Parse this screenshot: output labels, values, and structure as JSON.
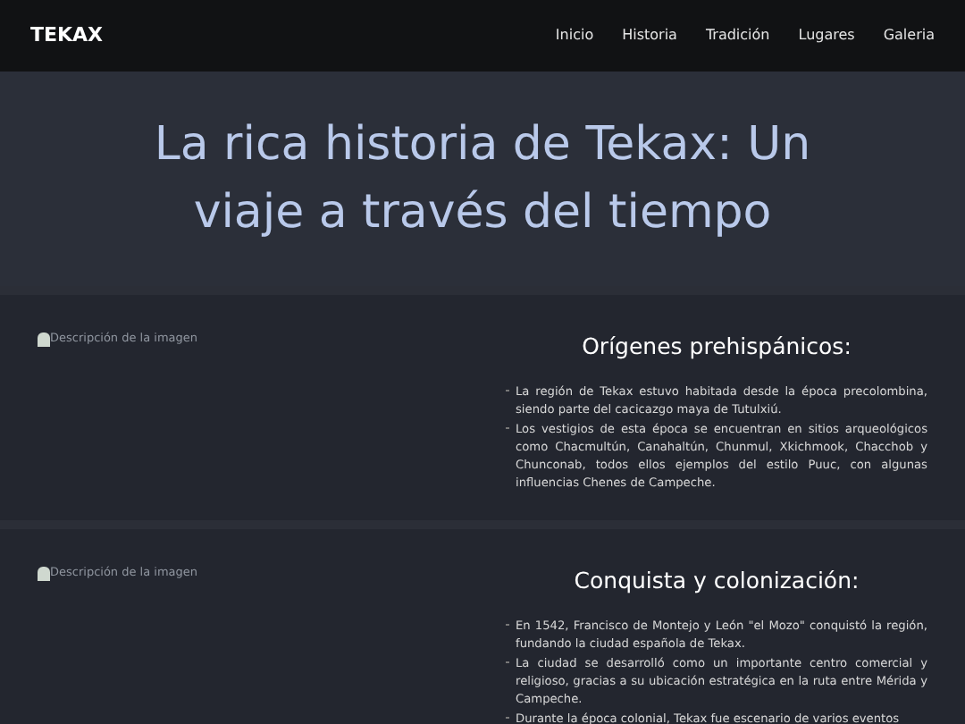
{
  "nav": {
    "brand": "TEKAX",
    "links": [
      "Inicio",
      "Historia",
      "Tradición",
      "Lugares",
      "Galeria"
    ]
  },
  "hero": {
    "title": "La rica historia de Tekax: Un viaje a través del tiempo"
  },
  "sections": [
    {
      "image_alt": "Descripción de la imagen",
      "heading": "Orígenes prehispánicos:",
      "bullets": [
        "La región de Tekax estuvo habitada desde la época precolombina, siendo parte del cacicazgo maya de Tutulxiú.",
        "Los vestigios de esta época se encuentran en sitios arqueológicos como Chacmultún, Canahaltún, Chunmul, Xkichmook, Chacchob y Chunconab, todos ellos ejemplos del estilo Puuc, con algunas influencias Chenes de Campeche."
      ]
    },
    {
      "image_alt": "Descripción de la imagen",
      "heading": "Conquista y colonización:",
      "bullets": [
        "En 1542, Francisco de Montejo y León \"el Mozo\" conquistó la región, fundando la ciudad española de Tekax.",
        "La ciudad se desarrolló como un importante centro comercial y religioso, gracias a su ubicación estratégica en la ruta entre Mérida y Campeche.",
        "Durante la época colonial, Tekax fue escenario de varios eventos"
      ]
    }
  ]
}
